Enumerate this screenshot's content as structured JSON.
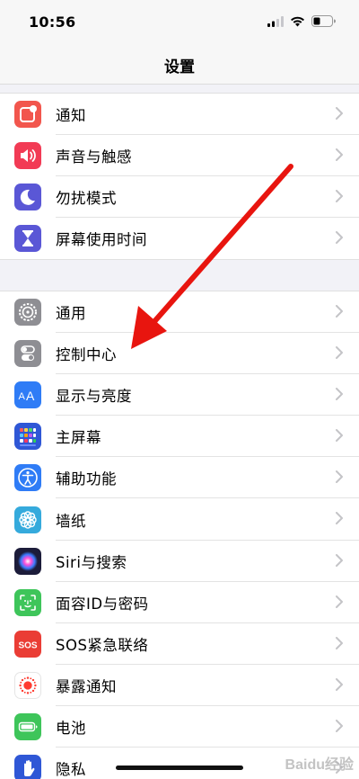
{
  "status": {
    "time": "10:56"
  },
  "nav": {
    "title": "设置"
  },
  "groups": [
    {
      "items": [
        {
          "label": "通知",
          "icon": "notification-icon",
          "color": "#f2564d"
        },
        {
          "label": "声音与触感",
          "icon": "speaker-icon",
          "color": "#f23b55"
        },
        {
          "label": "勿扰模式",
          "icon": "moon-icon",
          "color": "#5a57d6"
        },
        {
          "label": "屏幕使用时间",
          "icon": "hourglass-icon",
          "color": "#5a57d6"
        }
      ]
    },
    {
      "items": [
        {
          "label": "通用",
          "icon": "gear-icon",
          "color": "#8e8e93"
        },
        {
          "label": "控制中心",
          "icon": "toggles-icon",
          "color": "#8e8e93"
        },
        {
          "label": "显示与亮度",
          "icon": "text-size-icon",
          "color": "#2f7cf6"
        },
        {
          "label": "主屏幕",
          "icon": "home-grid-icon",
          "color": "#2f57d6"
        },
        {
          "label": "辅助功能",
          "icon": "accessibility-icon",
          "color": "#2f7cf6"
        },
        {
          "label": "墙纸",
          "icon": "flower-icon",
          "color": "#35aadc"
        },
        {
          "label": "Siri与搜索",
          "icon": "siri-icon",
          "color": "#1c1c3a"
        },
        {
          "label": "面容ID与密码",
          "icon": "face-id-icon",
          "color": "#3ec55a"
        },
        {
          "label": "SOS紧急联络",
          "icon": "sos-icon",
          "color": "#ea3d35"
        },
        {
          "label": "暴露通知",
          "icon": "exposure-icon",
          "color": "#ffffff"
        },
        {
          "label": "电池",
          "icon": "battery-icon",
          "color": "#3ec55a"
        },
        {
          "label": "隐私",
          "icon": "hand-icon",
          "color": "#2f57d6"
        }
      ]
    }
  ],
  "watermark": "Baidu经验"
}
